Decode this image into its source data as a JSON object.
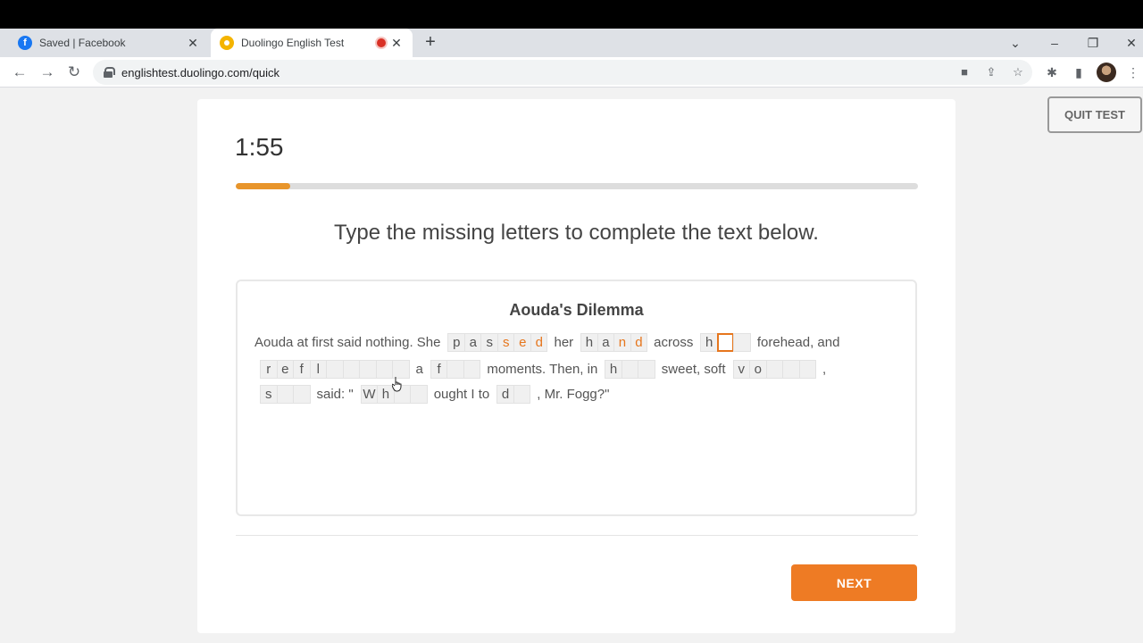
{
  "browser": {
    "tabs": [
      {
        "title": "Saved | Facebook",
        "favicon": "facebook-icon",
        "close": "✕"
      },
      {
        "title": "Duolingo English Test",
        "favicon": "duolingo-icon",
        "close": "✕",
        "recording": true
      }
    ],
    "new_tab": "+",
    "window_controls": {
      "menu": "⌄",
      "minimize": "–",
      "restore": "❐",
      "close": "✕"
    },
    "nav": {
      "back": "←",
      "forward": "→",
      "reload": "↻"
    },
    "url": "englishtest.duolingo.com/quick",
    "omnibox_icons": {
      "camera": "■",
      "share": "⇪",
      "bookmark": "☆"
    },
    "toolbar_icons": {
      "extensions": "✱",
      "side_panel": "▮",
      "menu": "⋮"
    }
  },
  "test": {
    "timer": "1:55",
    "progress_percent": 8,
    "prompt": "Type the missing letters to complete the text below.",
    "passage_title": "Aouda's Dilemma",
    "quit_label": "QUIT TEST",
    "next_label": "NEXT",
    "text": {
      "t1": "Aouda at first said nothing. She",
      "w1": [
        [
          "p",
          0
        ],
        [
          "a",
          0
        ],
        [
          "s",
          0
        ],
        [
          "s",
          1
        ],
        [
          "e",
          1
        ],
        [
          "d",
          1
        ]
      ],
      "t2": "her",
      "w2": [
        [
          "h",
          0
        ],
        [
          "a",
          0
        ],
        [
          "n",
          1
        ],
        [
          "d",
          1
        ]
      ],
      "t3": "across",
      "w3": [
        [
          "h",
          0
        ],
        [
          "",
          2
        ],
        [
          "",
          0
        ]
      ],
      "t4": "forehead, and",
      "w4": [
        [
          "r",
          0
        ],
        [
          "e",
          0
        ],
        [
          "f",
          0
        ],
        [
          "l",
          0
        ],
        [
          "",
          0
        ],
        [
          "",
          0
        ],
        [
          "",
          0
        ],
        [
          "",
          0
        ],
        [
          "",
          0
        ]
      ],
      "t5": "a",
      "w5": [
        [
          "f",
          0
        ],
        [
          "",
          0
        ],
        [
          "",
          0
        ]
      ],
      "t6": "moments. Then, in",
      "w6": [
        [
          "h",
          0
        ],
        [
          "",
          0
        ],
        [
          "",
          0
        ]
      ],
      "t7": "sweet, soft",
      "w7": [
        [
          "v",
          0
        ],
        [
          "o",
          0
        ],
        [
          "",
          0
        ],
        [
          "",
          0
        ],
        [
          "",
          0
        ]
      ],
      "t8": ",",
      "w8": [
        [
          "s",
          0
        ],
        [
          "",
          0
        ],
        [
          "",
          0
        ]
      ],
      "t9": "said: \"",
      "w9": [
        [
          "W",
          0
        ],
        [
          "h",
          0
        ],
        [
          "",
          0
        ],
        [
          "",
          0
        ]
      ],
      "t10": "ought I to",
      "w10": [
        [
          "d",
          0
        ],
        [
          "",
          0
        ]
      ],
      "t11": ", Mr. Fogg?\""
    }
  },
  "colors": {
    "accent": "#ee7b24",
    "progress": "#e8952b",
    "typed": "#e6761d"
  }
}
